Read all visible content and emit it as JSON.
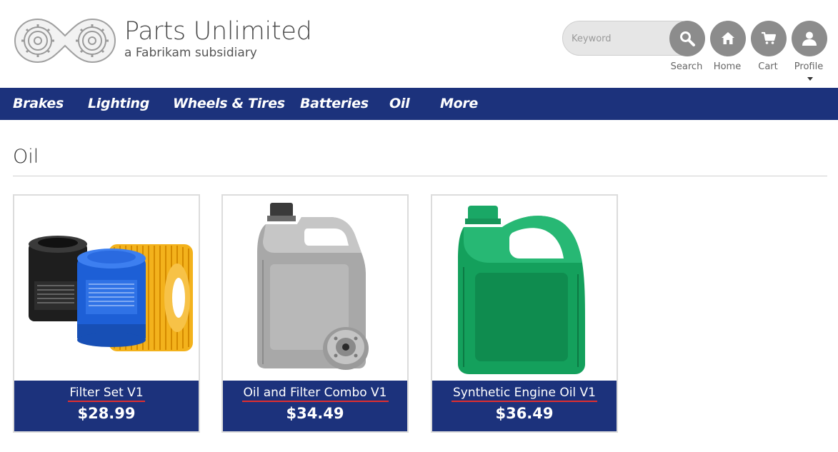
{
  "brand": {
    "title": "Parts Unlimited",
    "subtitle": "a Fabrikam subsidiary",
    "logo_icon": "gear-infinity-logo"
  },
  "search": {
    "placeholder": "Keyword",
    "button_label": "Search"
  },
  "header_buttons": [
    {
      "label": "Home",
      "icon": "home-icon"
    },
    {
      "label": "Cart",
      "icon": "cart-icon"
    },
    {
      "label": "Profile",
      "icon": "user-icon"
    }
  ],
  "nav": {
    "items": [
      "Brakes",
      "Lighting",
      "Wheels & Tires",
      "Batteries",
      "Oil",
      "More"
    ]
  },
  "page": {
    "title": "Oil"
  },
  "products": [
    {
      "name": "Filter Set V1",
      "price": "$28.99",
      "image": "oil-filters-image"
    },
    {
      "name": "Oil and Filter Combo V1",
      "price": "$34.49",
      "image": "grey-oil-jug-with-filter-image"
    },
    {
      "name": "Synthetic Engine Oil V1",
      "price": "$36.49",
      "image": "green-oil-jug-image"
    }
  ],
  "colors": {
    "nav_background": "#1c327c",
    "header_button": "#8c8c8c",
    "underline": "#e02f2f"
  }
}
